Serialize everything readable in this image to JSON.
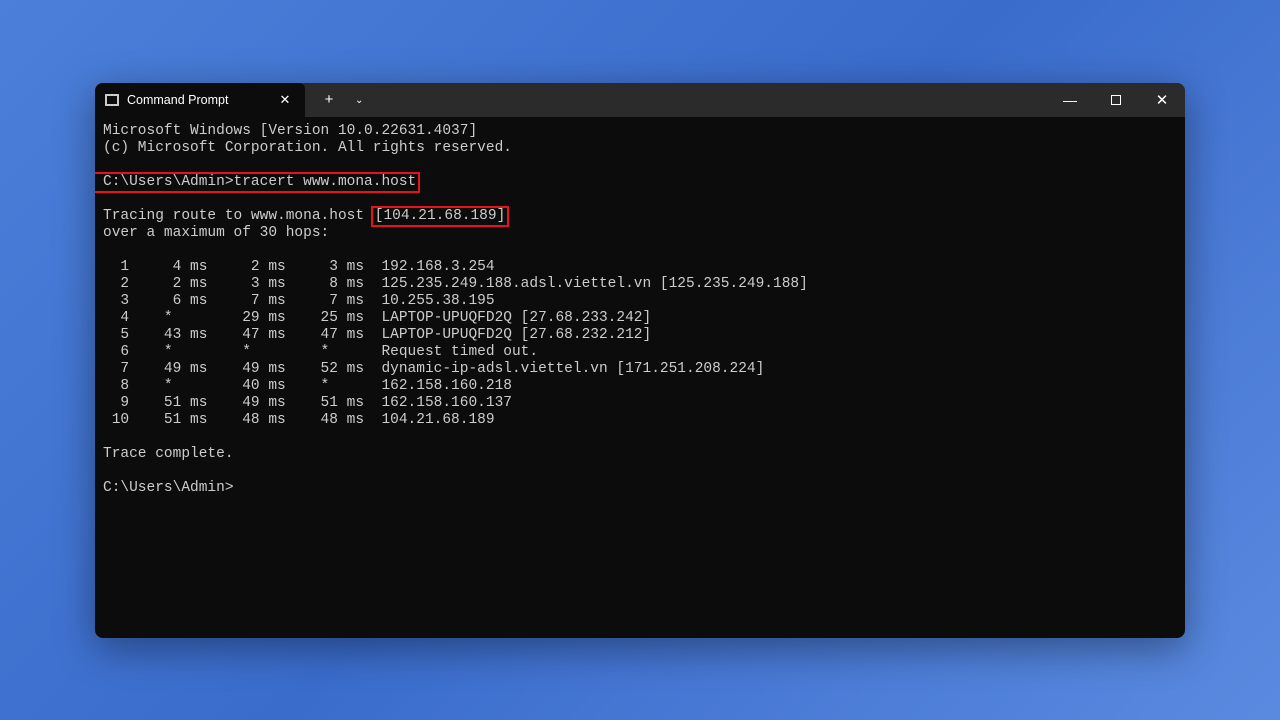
{
  "window": {
    "tab_title": "Command Prompt",
    "add_tab": "+"
  },
  "header": {
    "line1": "Microsoft Windows [Version 10.0.22631.4037]",
    "line2": "(c) Microsoft Corporation. All rights reserved."
  },
  "prompt_cmd": "C:\\Users\\Admin>tracert www.mona.host",
  "tracing_prefix": "Tracing route to www.mona.host ",
  "tracing_ip": "[104.21.68.189]",
  "over_max": "over a maximum of 30 hops:",
  "hops": [
    {
      "n": "1",
      "h1": "4 ms",
      "h2": "2 ms",
      "h3": "3 ms",
      "dest": "192.168.3.254"
    },
    {
      "n": "2",
      "h1": "2 ms",
      "h2": "3 ms",
      "h3": "8 ms",
      "dest": "125.235.249.188.adsl.viettel.vn [125.235.249.188]"
    },
    {
      "n": "3",
      "h1": "6 ms",
      "h2": "7 ms",
      "h3": "7 ms",
      "dest": "10.255.38.195"
    },
    {
      "n": "4",
      "h1": "*",
      "h2": "29 ms",
      "h3": "25 ms",
      "dest": "LAPTOP-UPUQFD2Q [27.68.233.242]"
    },
    {
      "n": "5",
      "h1": "43 ms",
      "h2": "47 ms",
      "h3": "47 ms",
      "dest": "LAPTOP-UPUQFD2Q [27.68.232.212]"
    },
    {
      "n": "6",
      "h1": "*",
      "h2": "*",
      "h3": "*",
      "dest": "Request timed out."
    },
    {
      "n": "7",
      "h1": "49 ms",
      "h2": "49 ms",
      "h3": "52 ms",
      "dest": "dynamic-ip-adsl.viettel.vn [171.251.208.224]"
    },
    {
      "n": "8",
      "h1": "*",
      "h2": "40 ms",
      "h3": "*",
      "dest": "162.158.160.218"
    },
    {
      "n": "9",
      "h1": "51 ms",
      "h2": "49 ms",
      "h3": "51 ms",
      "dest": "162.158.160.137"
    },
    {
      "n": "10",
      "h1": "51 ms",
      "h2": "48 ms",
      "h3": "48 ms",
      "dest": "104.21.68.189"
    }
  ],
  "complete": "Trace complete.",
  "prompt_end": "C:\\Users\\Admin>"
}
